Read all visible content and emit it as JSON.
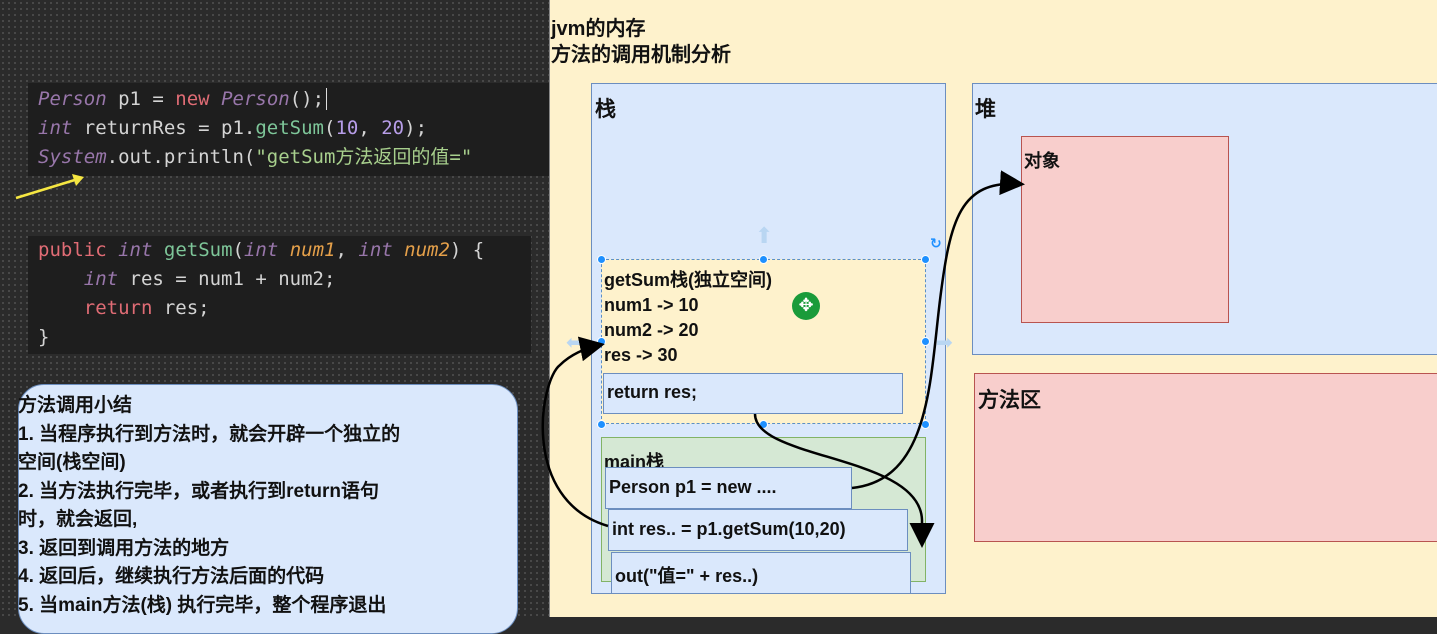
{
  "code1": {
    "line1": {
      "type": "Person",
      "rest1": " p1 = ",
      "kw": "new",
      "sp": " ",
      "type2": "Person",
      "rest2": "();"
    },
    "line2": {
      "type": "int",
      "rest1": " returnRes = p1.",
      "fn": "getSum",
      "p1": "(",
      "n1": "10",
      "comma": ", ",
      "n2": "20",
      "p2": ");"
    },
    "line3": {
      "cls": "System",
      "rest1": ".out.println(",
      "str": "\"getSum方法返回的值=\""
    }
  },
  "code2": {
    "line1": {
      "kw": "public",
      "sp1": " ",
      "type": "int",
      "sp2": " ",
      "fn": "getSum",
      "p1": "(",
      "t1": "int",
      "a1": " num1",
      "comma": ", ",
      "t2": "int",
      "a2": " num2",
      "p2": ") {"
    },
    "line2": {
      "indent": "    ",
      "type": "int",
      "rest": " res = num1 + num2;"
    },
    "line3": {
      "indent": "    ",
      "kw": "return",
      "rest": " res;"
    },
    "line4": "}"
  },
  "summary": {
    "title": "方法调用小结",
    "items": [
      "1. 当程序执行到方法时，就会开辟一个独立的",
      "空间(栈空间)",
      "2. 当方法执行完毕，或者执行到return语句",
      "时，就会返回,",
      "3. 返回到调用方法的地方",
      "4. 返回后，继续执行方法后面的代码",
      "5. 当main方法(栈) 执行完毕，整个程序退出"
    ]
  },
  "diagram": {
    "title1": "jvm的内存",
    "title2": "方法的调用机制分析",
    "stack_label": "栈",
    "heap_label": "堆",
    "object_label": "对象",
    "method_area_label": "方法区",
    "getsum_frame": {
      "title": "getSum栈(独立空间)",
      "lines": [
        "num1 -> 10",
        "num2 -> 20",
        "res -> 30"
      ],
      "return_box": "return res;"
    },
    "main_frame": {
      "title": "main栈",
      "boxes": [
        "Person p1 = new ....",
        "int res.. = p1.getSum(10,20)",
        "out(\"值=\" + res..)"
      ]
    }
  },
  "colors": {
    "diagram_bg": "#fef2cc",
    "stack_bg": "#dae8fc",
    "heap_bg": "#dae8fc",
    "object_bg": "#f8cecc",
    "main_frame_bg": "#d5e8d4",
    "summary_bg": "#dae8fc",
    "selection_handle": "#1e90ff"
  }
}
